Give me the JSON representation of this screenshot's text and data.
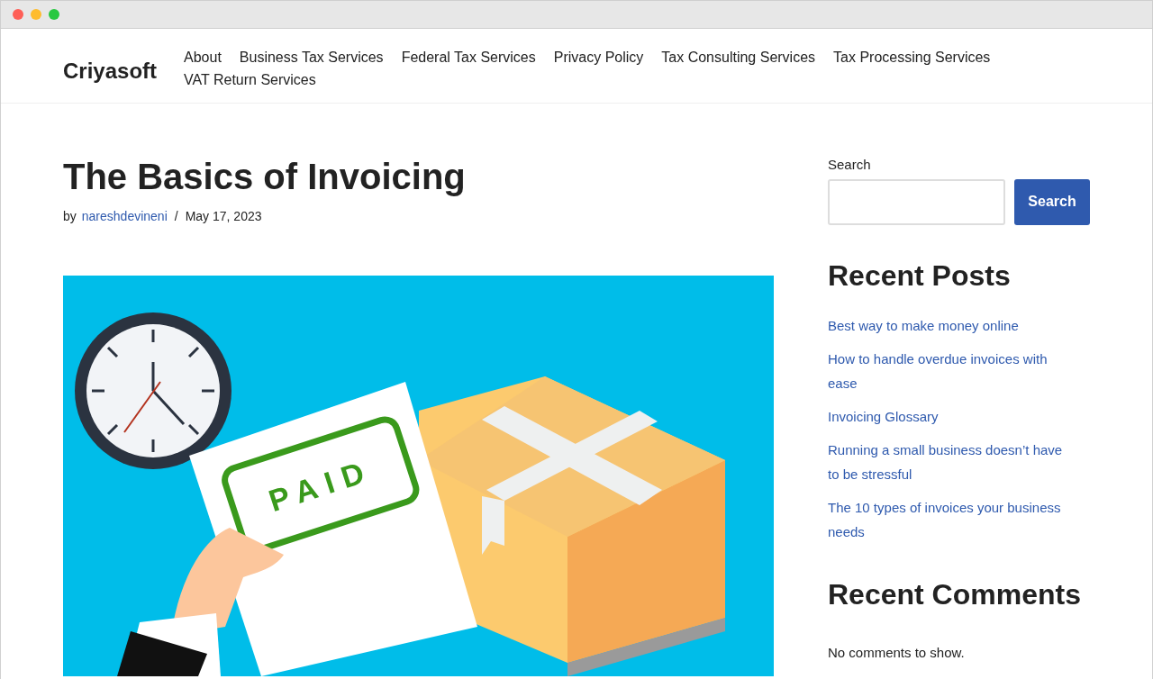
{
  "site": {
    "title": "Criyasoft"
  },
  "nav": [
    {
      "label": "About"
    },
    {
      "label": "Business Tax Services"
    },
    {
      "label": "Federal Tax Services"
    },
    {
      "label": "Privacy Policy"
    },
    {
      "label": "Tax Consulting Services"
    },
    {
      "label": "Tax Processing Services"
    },
    {
      "label": "VAT Return Services"
    }
  ],
  "post": {
    "title": "The Basics of Invoicing",
    "by": "by",
    "author": "nareshdevineni",
    "separator": "/",
    "date": "May 17, 2023",
    "featured_image": {
      "stamp_text": "PAID"
    }
  },
  "sidebar": {
    "search": {
      "label": "Search",
      "button": "Search"
    },
    "recent_posts": {
      "title": "Recent Posts",
      "items": [
        "Best way to make money online",
        "How to handle overdue invoices with ease",
        "Invoicing Glossary",
        "Running a small business doesn’t have to be stressful",
        "The 10 types of invoices your business needs"
      ]
    },
    "recent_comments": {
      "title": "Recent Comments",
      "empty": "No comments to show."
    }
  }
}
